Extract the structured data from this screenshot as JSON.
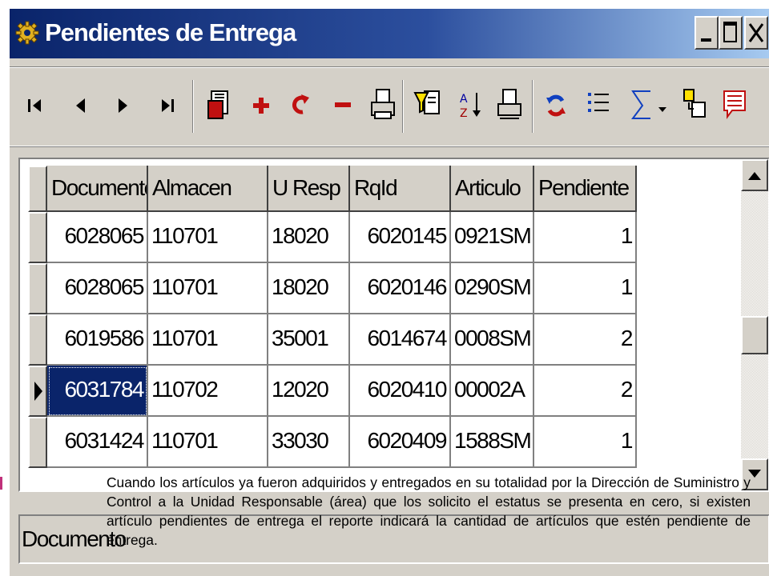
{
  "window": {
    "title": "Pendientes de Entrega",
    "controls": {
      "minimize": "_",
      "maximize": "□",
      "close": "X"
    }
  },
  "toolbar": {
    "buttons": [
      {
        "name": "first-record",
        "icon": "first-record-icon"
      },
      {
        "name": "prev-record",
        "icon": "prev-record-icon"
      },
      {
        "name": "next-record",
        "icon": "next-record-icon"
      },
      {
        "name": "last-record",
        "icon": "last-record-icon"
      },
      {
        "name": "report",
        "icon": "report-icon"
      },
      {
        "name": "add-record",
        "icon": "plus-icon"
      },
      {
        "name": "refresh-record",
        "icon": "undo-icon"
      },
      {
        "name": "delete-record",
        "icon": "minus-icon"
      },
      {
        "name": "print",
        "icon": "printer-icon"
      },
      {
        "name": "filter",
        "icon": "filter-icon"
      },
      {
        "name": "sort-az",
        "icon": "sort-az-icon"
      },
      {
        "name": "print-preview",
        "icon": "print-preview-icon"
      },
      {
        "name": "reload",
        "icon": "reload-icon"
      },
      {
        "name": "numbered-list",
        "icon": "numbered-list-icon"
      },
      {
        "name": "sum",
        "icon": "sigma-icon"
      },
      {
        "name": "sum-dropdown",
        "icon": "dropdown-arrow-icon"
      },
      {
        "name": "export",
        "icon": "export-icon"
      },
      {
        "name": "notes",
        "icon": "notes-icon"
      }
    ]
  },
  "grid": {
    "columns": [
      "Documento",
      "Almacen",
      "U Resp",
      "RqId",
      "Articulo",
      "Pendiente"
    ],
    "rows": [
      [
        "6028065",
        "110701",
        "18020",
        "6020145",
        "0921SM",
        "1"
      ],
      [
        "6028065",
        "110701",
        "18020",
        "6020146",
        "0290SM",
        "1"
      ],
      [
        "6019586",
        "110701",
        "35001",
        "6014674",
        "0008SM",
        "2"
      ],
      [
        "6031784",
        "110702",
        "12020",
        "6020410",
        "00002A",
        "2"
      ],
      [
        "6031424",
        "110701",
        "33030",
        "6020409",
        "1588SM",
        "1"
      ]
    ],
    "selected_row": 3
  },
  "status_bar": {
    "text": "Documento"
  },
  "note": "Cuando los artículos ya fueron adquiridos y entregados en su totalidad por la Dirección de Suministro y Control a la Unidad Responsable (área) que los solicito el estatus se presenta en cero, si existen artículo pendientes de entrega el reporte indicará la cantidad de artículos que estén pendiente de entrega.",
  "colors": {
    "title_gradient_start": "#0a246a",
    "title_gradient_end": "#a6caf0",
    "selection": "#0a246a",
    "face": "#d4d0c8"
  }
}
